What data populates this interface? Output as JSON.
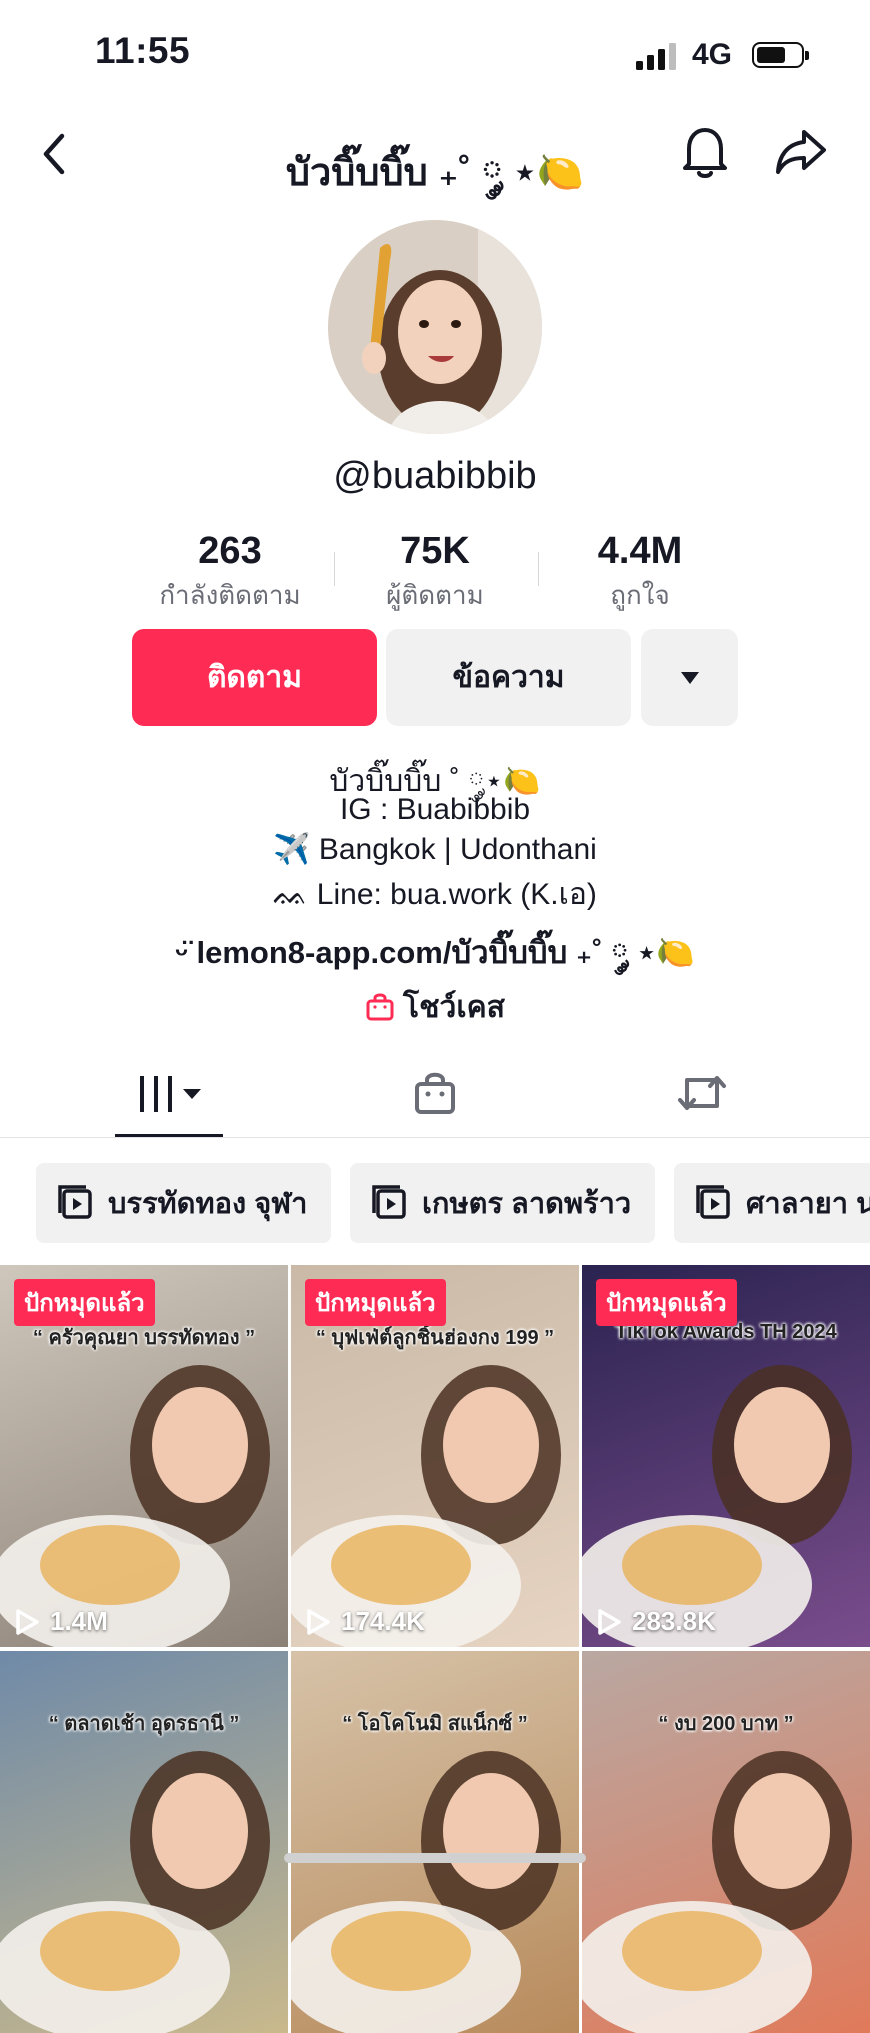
{
  "status": {
    "time": "11:55",
    "network": "4G"
  },
  "header": {
    "title": "บัวบิ๊บบิ๊บ ₊˚ ༘ ⋆🍋"
  },
  "profile": {
    "username": "@buabibbib"
  },
  "stats": [
    {
      "value": "263",
      "label": "กำลังติดตาม"
    },
    {
      "value": "75K",
      "label": "ผู้ติดตาม"
    },
    {
      "value": "4.4M",
      "label": "ถูกใจ"
    }
  ],
  "actions": {
    "follow": "ติดตาม",
    "message": "ข้อความ"
  },
  "bio": {
    "line1": "บัวบิ๊บบิ๊บ ˚ ༘⋆🍋",
    "line2": "IG : Buabibbib",
    "line3": "✈️ Bangkok | Udonthani",
    "line4": "ᨐ Line: bua.work (K.เอ)",
    "link": "lemon8-app.com/บัวบิ๊บบิ๊บ ₊˚ ༘ ⋆🍋",
    "showcase": "โชว์เคส"
  },
  "playlists": [
    {
      "label": "บรรทัดทอง จุฬา"
    },
    {
      "label": "เกษตร ลาดพร้าว"
    },
    {
      "label": "ศาลายา นครปฐม"
    }
  ],
  "videos": [
    {
      "pinned": "ปักหมุดแล้ว",
      "views": "1.4M",
      "caption": "“ ครัวคุณยา บรรทัดทอง ”",
      "colors": [
        "#cfc7bc",
        "#8c8176"
      ]
    },
    {
      "pinned": "ปักหมุดแล้ว",
      "views": "174.4K",
      "caption": "“ บุฟเฟ่ต์ลูกชิ้นฮ่องกง 199 ”",
      "colors": [
        "#c9b9a6",
        "#e7d4c2"
      ]
    },
    {
      "pinned": "ปักหมุดแล้ว",
      "views": "283.8K",
      "caption": "TikTok Awards TH 2024",
      "colors": [
        "#2a2350",
        "#7a4d8c"
      ]
    },
    {
      "pinned": "",
      "views": "",
      "caption": "“ ตลาดเช้า อุดรธานี ”",
      "colors": [
        "#6f8aa8",
        "#c9b98c"
      ]
    },
    {
      "pinned": "",
      "views": "",
      "caption": "“ โอโคโนมิ สแน็กซ์ ”",
      "colors": [
        "#d6c2a8",
        "#b88b5c"
      ]
    },
    {
      "pinned": "",
      "views": "",
      "caption": "“ งบ 200 บาท ”",
      "colors": [
        "#b9a8a2",
        "#e07a5a"
      ]
    }
  ],
  "theme": {
    "accent": "#fe2c55",
    "text": "#161823",
    "muted": "#6b6d76"
  }
}
